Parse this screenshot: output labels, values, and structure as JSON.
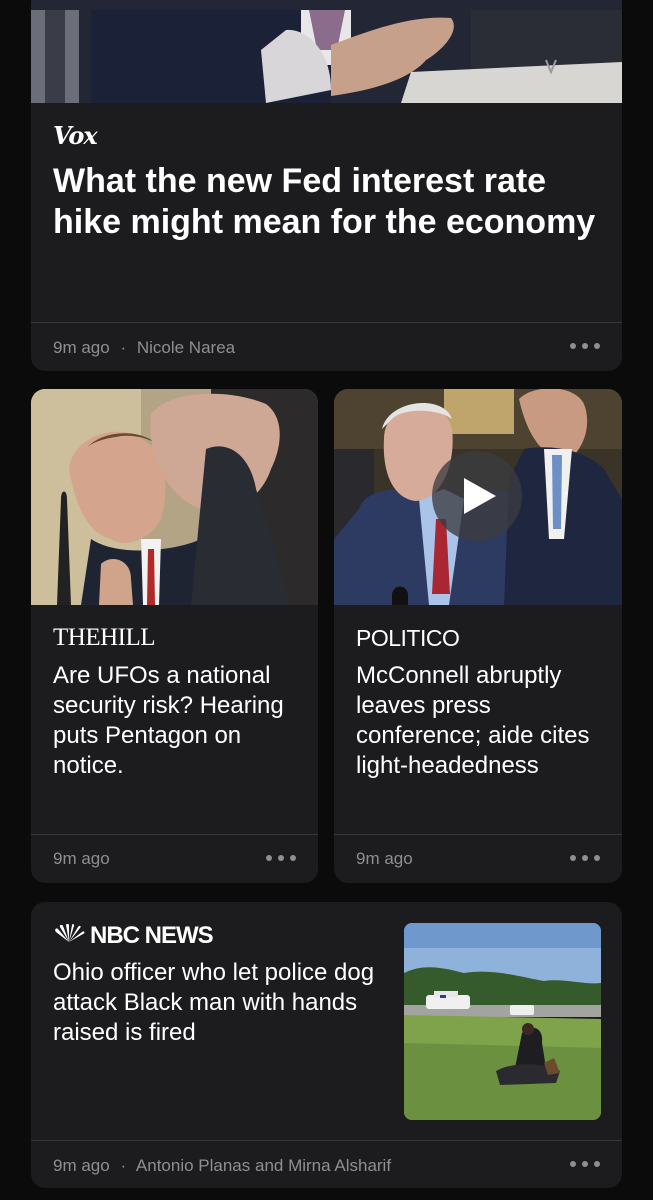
{
  "feed": {
    "articles": [
      {
        "source": "Vox",
        "headline": "What the new Fed interest rate hike might mean for the economy",
        "age": "9m ago",
        "separator": "·",
        "author": "Nicole Narea"
      },
      {
        "source": "THEHILL",
        "headline": "Are UFOs a national security risk? Hearing puts Pentagon on notice.",
        "age": "9m ago"
      },
      {
        "source": "POLITICO",
        "headline": "McConnell abruptly leaves press conference; aide cites light-headedness",
        "age": "9m ago"
      },
      {
        "source": "NBC NEWS",
        "headline": "Ohio officer who let police dog attack Black man with hands raised is fired",
        "age": "9m ago",
        "separator": "·",
        "author": "Antonio Planas and Mirna Alsharif"
      }
    ]
  },
  "icons": {
    "more": "more-dots-icon",
    "play": "play-icon",
    "nbc": "nbc-peacock-icon"
  },
  "colors": {
    "background": "#0b0b0c",
    "card": "#1c1c1e",
    "secondary_text": "#8e8e93"
  }
}
